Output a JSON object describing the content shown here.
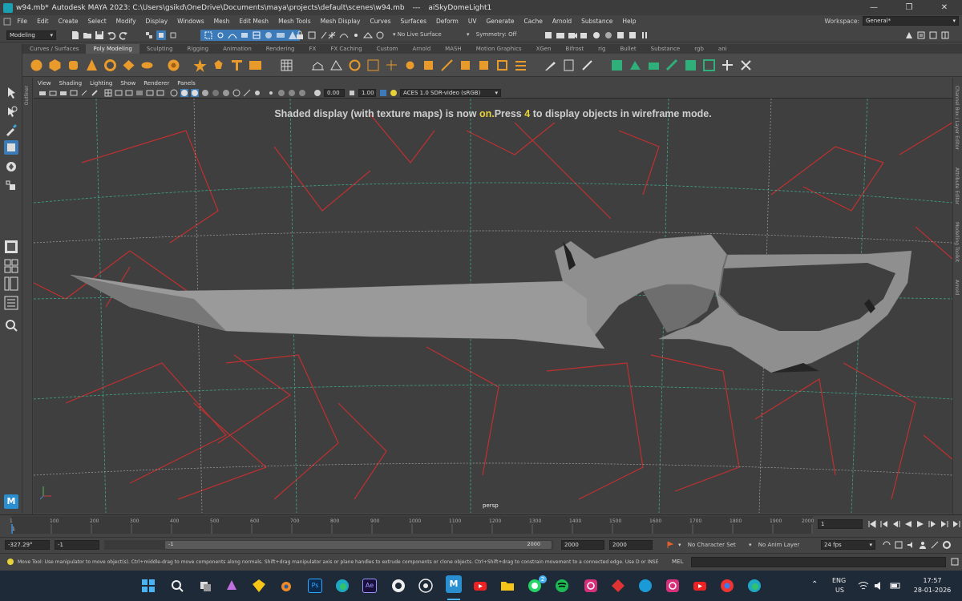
{
  "window": {
    "file": "w94.mb*",
    "app_path": "Autodesk MAYA 2023: C:\\Users\\gsikd\\OneDrive\\Documents\\maya\\projects\\default\\scenes\\w94.mb",
    "dashes": "---",
    "selection": "aiSkyDomeLight1"
  },
  "menu": [
    "File",
    "Edit",
    "Create",
    "Select",
    "Modify",
    "Display",
    "Windows",
    "Mesh",
    "Edit Mesh",
    "Mesh Tools",
    "Mesh Display",
    "Curves",
    "Surfaces",
    "Deform",
    "UV",
    "Generate",
    "Cache",
    "Arnold",
    "Substance",
    "Help"
  ],
  "workspace": {
    "label": "Workspace:",
    "value": "General*"
  },
  "status_line": {
    "menuset": "Modeling",
    "live_surface": "No Live Surface",
    "symmetry": "Symmetry: Off"
  },
  "shelf_tabs": [
    "Curves / Surfaces",
    "Poly Modeling",
    "Sculpting",
    "Rigging",
    "Animation",
    "Rendering",
    "FX",
    "FX Caching",
    "Custom",
    "Arnold",
    "MASH",
    "Motion Graphics",
    "XGen",
    "Bifrost",
    "rig",
    "Bullet",
    "Substance",
    "rgb",
    "ani"
  ],
  "shelf_active": "Poly Modeling",
  "panel_menu": [
    "View",
    "Shading",
    "Lighting",
    "Show",
    "Renderer",
    "Panels"
  ],
  "panel_tools": {
    "exposure": "0.00",
    "gamma": "1.00",
    "color_space": "ACES 1.0 SDR-video (sRGB)"
  },
  "hud": {
    "pre": "Shaded display (with texture maps) is now",
    "on": "on.",
    "mid": "Press",
    "key": "4",
    "post": "to display objects in wireframe mode."
  },
  "camera_label": "persp",
  "outliner_label": "Outliner",
  "right_tabs": [
    "Channel Box / Layer Editor",
    "Attribute Editor",
    "Modelling Toolkit",
    "Arnold"
  ],
  "timeline": {
    "ticks": [
      "1",
      "100",
      "200",
      "300",
      "400",
      "500",
      "600",
      "700",
      "800",
      "900",
      "1000",
      "1100",
      "1200",
      "1300",
      "1400",
      "1500",
      "1600",
      "1700",
      "1800",
      "1900",
      "2000"
    ],
    "current_frame_marker": "1",
    "current_frame": "1"
  },
  "range": {
    "coord": "-327.29°",
    "start": "-1",
    "range_start": "-1",
    "range_end": "2000",
    "anim_end": "2000",
    "end": "2000",
    "character_set": "No Character Set",
    "anim_layer": "No Anim Layer",
    "fps": "24 fps"
  },
  "help": {
    "text": "Move Tool: Use manipulator to move object(s). Ctrl+middle-drag to move components along normals. Shift+drag manipulator axis or plane handles to extrude components or clone objects. Ctrl+Shift+drag to constrain movement to a connected edge. Use D or INSERT to change the pivot p",
    "mel": "MEL"
  },
  "taskbar": {
    "lang": "ENG",
    "region": "US",
    "time": "17:57",
    "date": "28-01-2026",
    "badge": "2"
  },
  "colors": {
    "accent": "#3d7ab8",
    "hud_highlight": "#e8d23a",
    "grid_green": "#3fa48a",
    "grid_white": "#cfcfcf",
    "frustum_red": "#c03030",
    "mesh": "#8f8f8f"
  }
}
